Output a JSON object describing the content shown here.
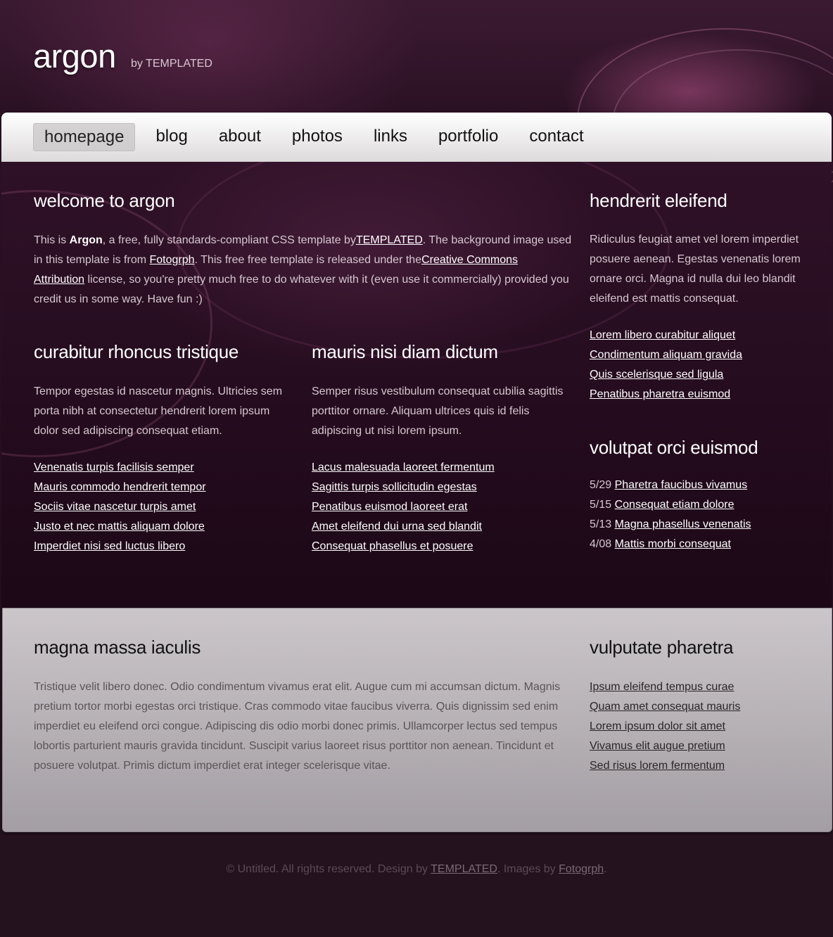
{
  "header": {
    "logo": "argon",
    "byline": "by TEMPLATED"
  },
  "nav": {
    "items": [
      "homepage",
      "blog",
      "about",
      "photos",
      "links",
      "portfolio",
      "contact"
    ],
    "active": "homepage"
  },
  "welcome": {
    "title": "welcome to argon",
    "p1": "This is ",
    "brand": "Argon",
    "p2": ", a free, fully standards-compliant CSS template by",
    "templated_link": "TEMPLATED",
    "p3": ". The background image used in this template is from ",
    "fotogrph_link": "Fotogrph",
    "p4": ". This free free template is released under the",
    "cc_link1": "Creative Commons",
    "cc_link2": "Attribution",
    "p5": " license, so you're pretty much free to do whatever with it (even use it commercially) provided you credit us in some way. Have fun :)"
  },
  "left_col": {
    "title": "curabitur rhoncus tristique",
    "text": "Tempor egestas id nascetur magnis. Ultricies sem porta nibh at consectetur hendrerit lorem ipsum dolor sed adipiscing consequat etiam.",
    "links": [
      "Venenatis turpis facilisis semper",
      "Mauris commodo hendrerit tempor",
      "Sociis vitae nascetur turpis amet",
      "Justo et nec mattis aliquam dolore",
      "Imperdiet nisi sed luctus libero"
    ]
  },
  "mid_col": {
    "title": "mauris nisi diam dictum",
    "text": "Semper risus vestibulum consequat cubilia sagittis porttitor ornare. Aliquam ultrices quis id felis adipiscing ut nisi lorem ipsum.",
    "links": [
      "Lacus malesuada laoreet fermentum",
      "Sagittis turpis sollicitudin egestas",
      "Penatibus euismod laoreet erat",
      "Amet eleifend dui urna sed blandit",
      "Consequat phasellus et posuere"
    ]
  },
  "sidebar": {
    "title1": "hendrerit eleifend",
    "text": "Ridiculus feugiat amet vel lorem imperdiet posuere aenean. Egestas venenatis lorem ornare orci. Magna id nulla dui leo blandit eleifend est mattis consequat.",
    "links": [
      "Lorem libero curabitur aliquet",
      "Condimentum aliquam gravida",
      "Quis scelerisque sed ligula",
      "Penatibus pharetra euismod"
    ],
    "title2": "volutpat orci euismod",
    "dated": [
      {
        "date": "5/29 ",
        "link": "Pharetra faucibus vivamus"
      },
      {
        "date": "5/15 ",
        "link": "Consequat etiam dolore"
      },
      {
        "date": "5/13 ",
        "link": "Magna phasellus venenatis"
      },
      {
        "date": "4/08 ",
        "link": "Mattis morbi consequat"
      }
    ]
  },
  "footer_panel": {
    "title": "magna massa iaculis",
    "text": "Tristique velit libero donec. Odio condimentum vivamus erat elit. Augue cum mi accumsan dictum. Magnis pretium tortor morbi egestas orci tristique. Cras commodo vitae faucibus viverra. Quis dignissim sed enim imperdiet eu eleifend orci congue. Adipiscing dis odio morbi donec primis. Ullamcorper lectus sed tempus lobortis parturient mauris gravida tincidunt. Suscipit varius laoreet risus porttitor non aenean. Tincidunt et posuere volutpat. Primis dictum imperdiet erat integer scelerisque vitae.",
    "title2": "vulputate pharetra",
    "links": [
      "Ipsum eleifend tempus curae",
      "Quam amet consequat mauris",
      "Lorem ipsum dolor sit amet",
      "Vivamus elit augue pretium",
      "Sed risus lorem fermentum"
    ]
  },
  "copyright": {
    "t1": "© Untitled. All rights reserved. Design by ",
    "link1": "TEMPLATED",
    "t2": ". Images by ",
    "link2": "Fotogrph",
    "t3": "."
  }
}
